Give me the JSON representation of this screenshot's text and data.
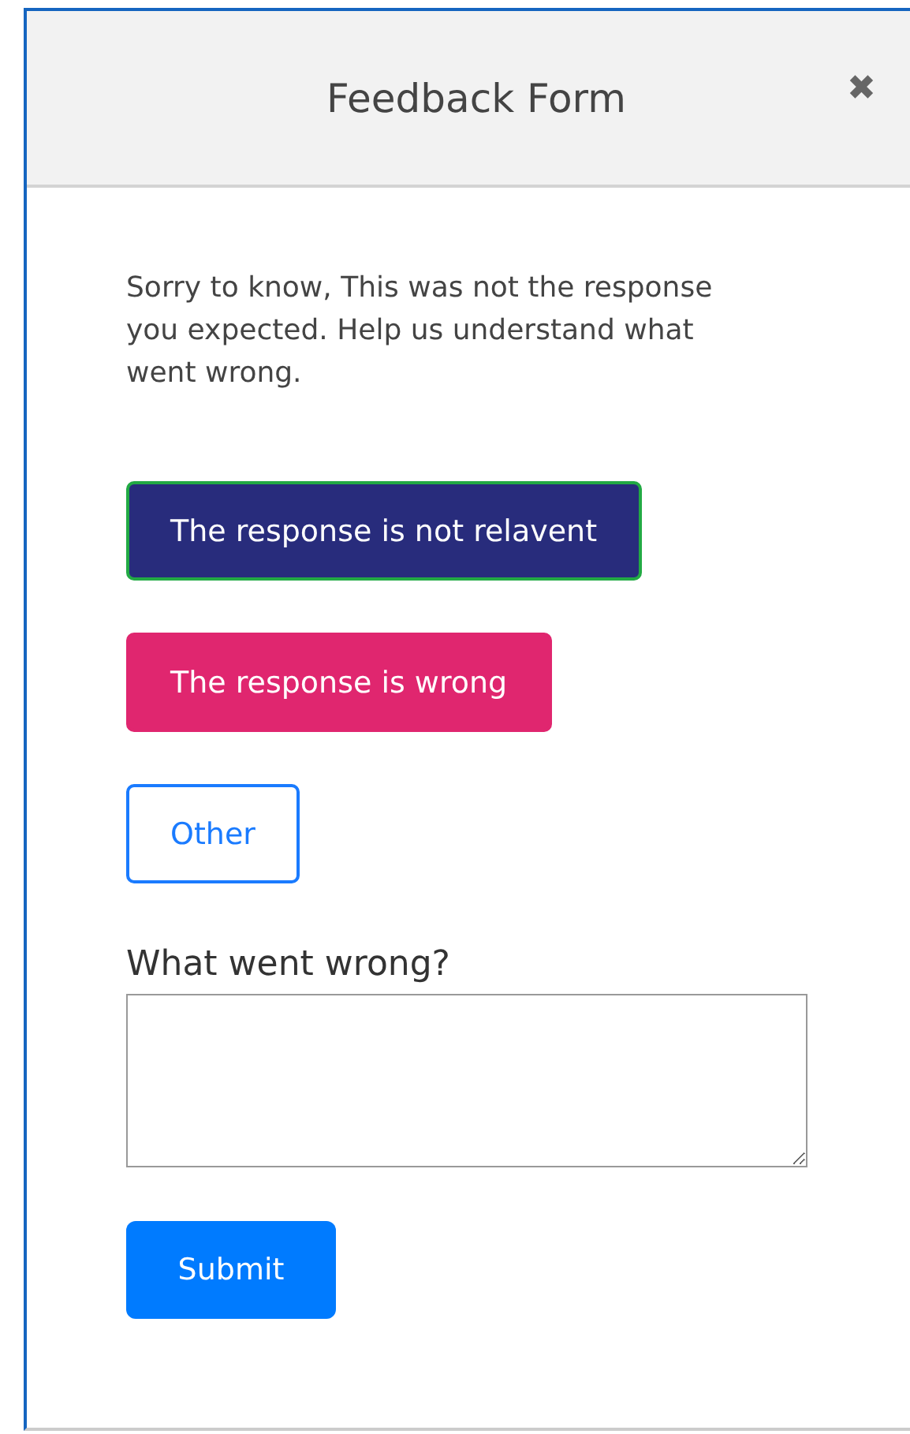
{
  "dialog": {
    "title": "Feedback Form",
    "close": "✖"
  },
  "message": "Sorry to know, This was not the response you expected. Help us understand what went wrong.",
  "options": [
    {
      "label": "The response is not relavent",
      "kind": "filled",
      "color": "#282c7c",
      "selected": true
    },
    {
      "label": "The response is wrong",
      "kind": "filled",
      "color": "#e0266f",
      "selected": false
    },
    {
      "label": "Other",
      "kind": "outline",
      "color": "#1a7bff",
      "selected": false
    }
  ],
  "comment": {
    "label": "What went wrong?"
  },
  "submit": "Submit"
}
